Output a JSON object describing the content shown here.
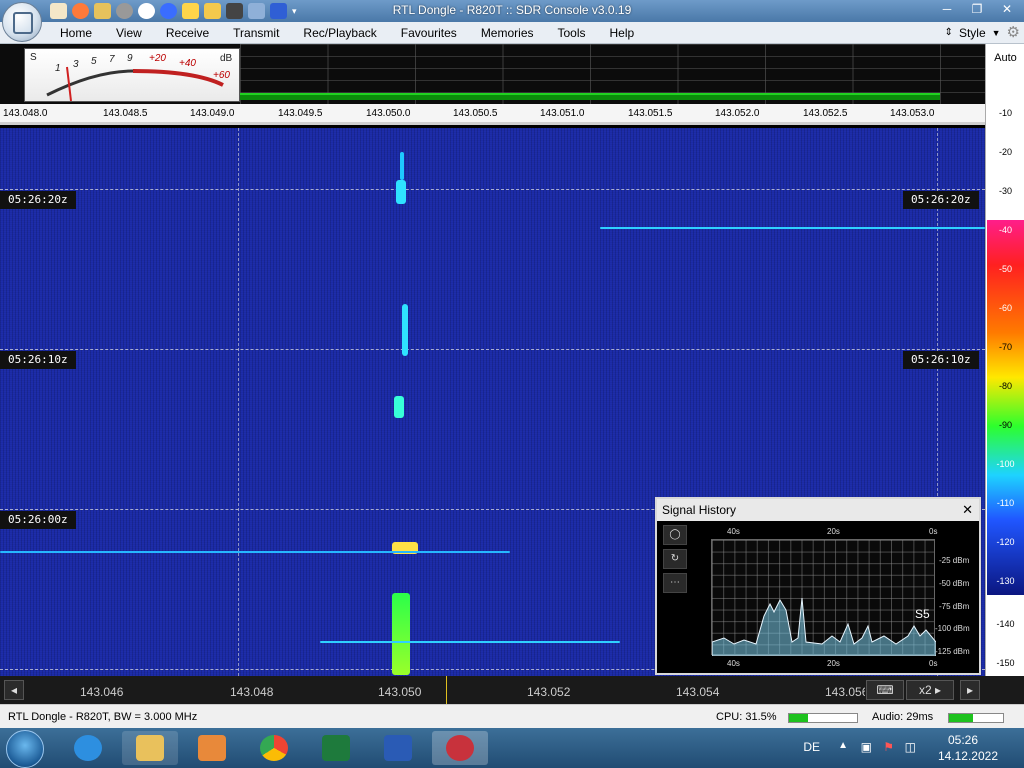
{
  "window": {
    "title": "RTL Dongle - R820T :: SDR Console v3.0.19"
  },
  "menu": {
    "items": [
      "Home",
      "View",
      "Receive",
      "Transmit",
      "Rec/Playback",
      "Favourites",
      "Memories",
      "Tools",
      "Help"
    ],
    "style_label": "Style"
  },
  "smeter": {
    "s_label": "S",
    "db_label": "dB",
    "scale": [
      "1",
      "3",
      "5",
      "7",
      "9",
      "+20",
      "+40",
      "+60"
    ]
  },
  "freq_scale": [
    "143.048.0",
    "143.048.5",
    "143.049.0",
    "143.049.5",
    "143.050.0",
    "143.050.5",
    "143.051.0",
    "143.051.5",
    "143.052.0",
    "143.052.5",
    "143.053.0"
  ],
  "db_scale": {
    "auto_label": "Auto",
    "labels": [
      "-10",
      "-20",
      "-30",
      "-40",
      "-50",
      "-60",
      "-70",
      "-80",
      "-90",
      "-100",
      "-110",
      "-120",
      "-130",
      "-140",
      "-150"
    ]
  },
  "waterfall": {
    "time_labels": [
      "05:26:20z",
      "05:26:10z",
      "05:26:00z"
    ]
  },
  "signal_history": {
    "title": "Signal History",
    "close_symbol": "✕",
    "tools": [
      "◯",
      "↻",
      "⋯"
    ],
    "top_labels": [
      "40s",
      "20s",
      "0s"
    ],
    "bottom_labels": [
      "40s",
      "20s",
      "0s"
    ],
    "y_labels": [
      "-25 dBm",
      "-50 dBm",
      "-75 dBm",
      "-100 dBm",
      "-125 dBm"
    ],
    "smeter_reading": "S5"
  },
  "bottom_freq": {
    "labels": [
      "143.046",
      "143.048",
      "143.050",
      "143.052",
      "143.054",
      "143.056"
    ],
    "zoom_label": "x2"
  },
  "status": {
    "left": "RTL Dongle - R820T, BW = 3.000 MHz",
    "cpu": "CPU: 31.5%",
    "cpu_level": 0.28,
    "audio": "Audio: 29ms",
    "audio_level": 0.45
  },
  "taskbar": {
    "language": "DE",
    "time": "05:26",
    "date": "14.12.2022"
  },
  "colors": {
    "waterfall_bg": "#1b2aa4",
    "signal": "#1ec8ff",
    "spectrum": "#21d321"
  }
}
